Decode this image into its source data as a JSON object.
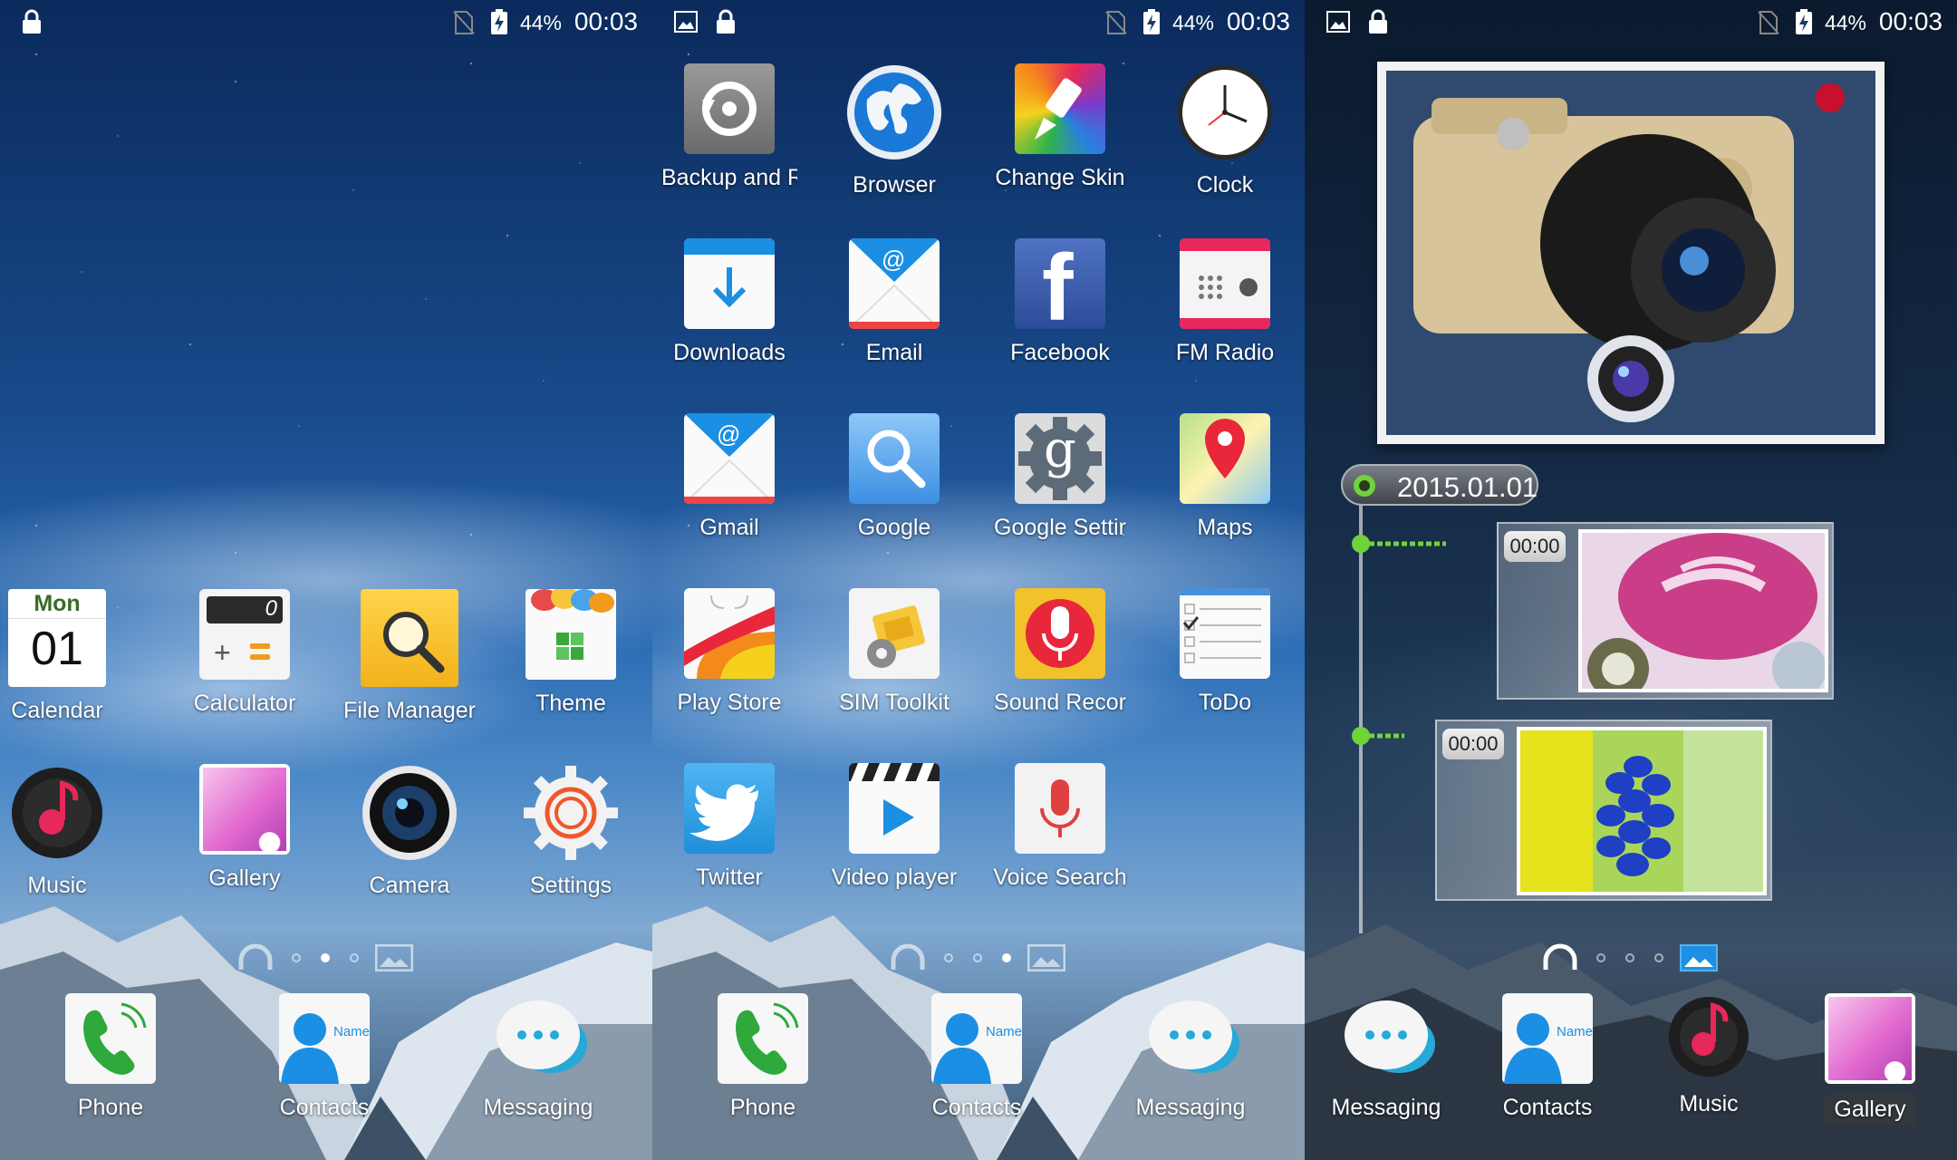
{
  "status_bar": {
    "battery": "44%",
    "time": "00:03"
  },
  "panel1": {
    "calendar": {
      "day_name": "Mon",
      "day_num": "01"
    },
    "calculator_display": "0",
    "apps": [
      {
        "label": "Calendar"
      },
      {
        "label": "Calculator"
      },
      {
        "label": "File Manager"
      },
      {
        "label": "Theme"
      },
      {
        "label": "Music"
      },
      {
        "label": "Gallery"
      },
      {
        "label": "Camera"
      },
      {
        "label": "Settings"
      }
    ],
    "dock": [
      {
        "label": "Phone"
      },
      {
        "label": "Contacts"
      },
      {
        "label": "Messaging"
      }
    ]
  },
  "panel2": {
    "apps": [
      {
        "label": "Backup and R"
      },
      {
        "label": "Browser"
      },
      {
        "label": "Change Skin"
      },
      {
        "label": "Clock"
      },
      {
        "label": "Downloads"
      },
      {
        "label": "Email"
      },
      {
        "label": "Facebook"
      },
      {
        "label": "FM Radio"
      },
      {
        "label": "Gmail"
      },
      {
        "label": "Google"
      },
      {
        "label": "Google Settir"
      },
      {
        "label": "Maps"
      },
      {
        "label": "Play Store"
      },
      {
        "label": "SIM Toolkit"
      },
      {
        "label": "Sound Recor"
      },
      {
        "label": "ToDo"
      },
      {
        "label": "Twitter"
      },
      {
        "label": "Video player"
      },
      {
        "label": "Voice Search"
      }
    ],
    "dock": [
      {
        "label": "Phone"
      },
      {
        "label": "Contacts"
      },
      {
        "label": "Messaging"
      }
    ]
  },
  "panel3": {
    "timeline_date": "2015.01.01",
    "entries": [
      {
        "time": "00:00"
      },
      {
        "time": "00:00"
      }
    ],
    "dock": [
      {
        "label": "Messaging"
      },
      {
        "label": "Contacts"
      },
      {
        "label": "Music"
      },
      {
        "label": "Gallery"
      }
    ]
  },
  "icon_text": {
    "contacts_name": "Name",
    "facebook_glyph": "f",
    "google_settings_glyph": "g",
    "at_sign": "@"
  },
  "colors": {
    "accent_green": "#6fd33a",
    "music_pink": "#e8275a",
    "phone_green": "#2fa83c"
  }
}
